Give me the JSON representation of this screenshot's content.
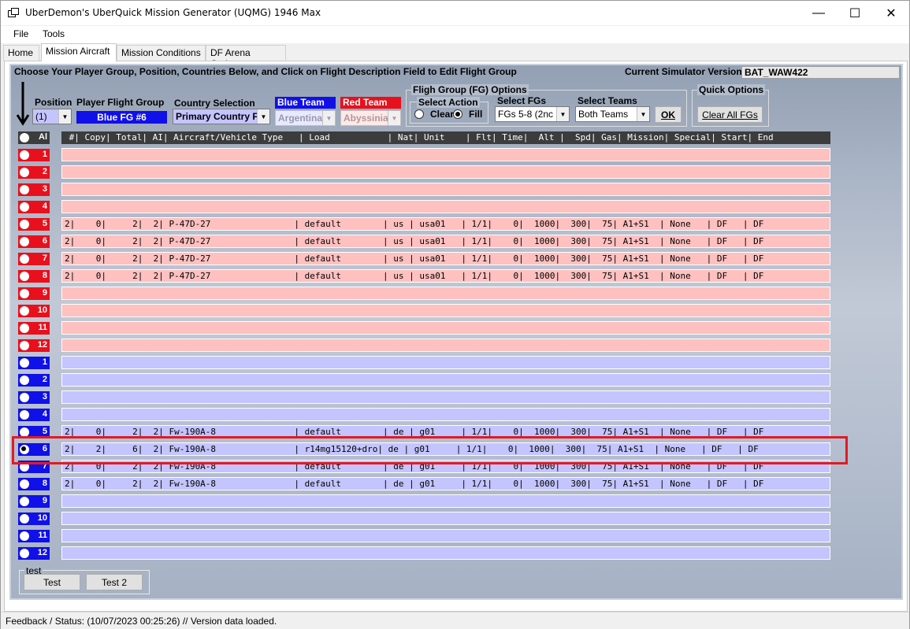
{
  "window": {
    "title": "UberDemon's UberQuick Mission Generator (UQMG) 1946 Max"
  },
  "menu": [
    "File",
    "Tools"
  ],
  "tabs": [
    "Home",
    "Mission Aircraft",
    "Mission Conditions",
    "DF Arena Options"
  ],
  "instructions": "Choose Your Player Group, Position, Countries Below, and Click on Flight Description Field to Edit Flight Group",
  "simulator": {
    "label": "Current Simulator Version:",
    "value": "BAT_WAW422"
  },
  "controls": {
    "position_label": "Position",
    "position_value": "(1)",
    "player_fg_label": "Player Flight Group",
    "player_fg_value": "Blue FG #6",
    "country_label": "Country Selection",
    "country_value": "Primary Country F",
    "blue_team_label": "Blue Team",
    "blue_team_value": "Argentina",
    "red_team_label": "Red Team",
    "red_team_value": "Abyssinia",
    "fg_options_title": "Fligh Group (FG) Options",
    "select_action_title": "Select Action",
    "clear_label": "Clear",
    "fill_label": "Fill",
    "select_fgs_label": "Select FGs",
    "select_fgs_value": "FGs 5-8  (2nc",
    "select_teams_label": "Select Teams",
    "select_teams_value": "Both Teams",
    "ok_label": "OK",
    "quick_options_title": "Quick Options",
    "clear_all_label": "Clear All FGs",
    "all_label": "Al"
  },
  "table_header": " #| Copy| Total| AI| Aircraft/Vehicle Type   | Load           | Nat| Unit    | Flt| Time|  Alt |  Spd| Gas| Mission| Special| Start| End",
  "red_rows": [
    {
      "num": "1",
      "text": ""
    },
    {
      "num": "2",
      "text": ""
    },
    {
      "num": "3",
      "text": ""
    },
    {
      "num": "4",
      "text": ""
    },
    {
      "num": "5",
      "text": "2|    0|     2|  2| P-47D-27                | default        | us | usa01   | 1/1|    0|  1000|  300|  75| A1+S1  | None   | DF   | DF"
    },
    {
      "num": "6",
      "text": "2|    0|     2|  2| P-47D-27                | default        | us | usa01   | 1/1|    0|  1000|  300|  75| A1+S1  | None   | DF   | DF"
    },
    {
      "num": "7",
      "text": "2|    0|     2|  2| P-47D-27                | default        | us | usa01   | 1/1|    0|  1000|  300|  75| A1+S1  | None   | DF   | DF"
    },
    {
      "num": "8",
      "text": "2|    0|     2|  2| P-47D-27                | default        | us | usa01   | 1/1|    0|  1000|  300|  75| A1+S1  | None   | DF   | DF"
    },
    {
      "num": "9",
      "text": ""
    },
    {
      "num": "10",
      "text": ""
    },
    {
      "num": "11",
      "text": ""
    },
    {
      "num": "12",
      "text": ""
    }
  ],
  "blue_rows": [
    {
      "num": "1",
      "text": ""
    },
    {
      "num": "2",
      "text": ""
    },
    {
      "num": "3",
      "text": ""
    },
    {
      "num": "4",
      "text": ""
    },
    {
      "num": "5",
      "text": "2|    0|     2|  2| Fw-190A-8               | default        | de | g01     | 1/1|    0|  1000|  300|  75| A1+S1  | None   | DF   | DF"
    },
    {
      "num": "6",
      "text": "2|    2|     6|  2| Fw-190A-8               | r14mg15120+dro| de | g01     | 1/1|    0|  1000|  300|  75| A1+S1  | None   | DF   | DF"
    },
    {
      "num": "7",
      "text": "2|    0|     2|  2| Fw-190A-8               | default        | de | g01     | 1/1|    0|  1000|  300|  75| A1+S1  | None   | DF   | DF"
    },
    {
      "num": "8",
      "text": "2|    0|     2|  2| Fw-190A-8               | default        | de | g01     | 1/1|    0|  1000|  300|  75| A1+S1  | None   | DF   | DF"
    },
    {
      "num": "9",
      "text": ""
    },
    {
      "num": "10",
      "text": ""
    },
    {
      "num": "11",
      "text": ""
    },
    {
      "num": "12",
      "text": ""
    }
  ],
  "selected": {
    "team": "blue",
    "index": 5
  },
  "test_group": {
    "title": "test",
    "buttons": [
      "Test",
      "Test 2"
    ]
  },
  "status": "Feedback / Status:  (10/07/2023 00:25:26) // Version data loaded.",
  "colors": {
    "red_btn": "#e8101c",
    "blue_btn": "#1010e8",
    "red_row": "#ffc0c0",
    "blue_row": "#c4c4ff",
    "highlight": "#e01b24"
  }
}
